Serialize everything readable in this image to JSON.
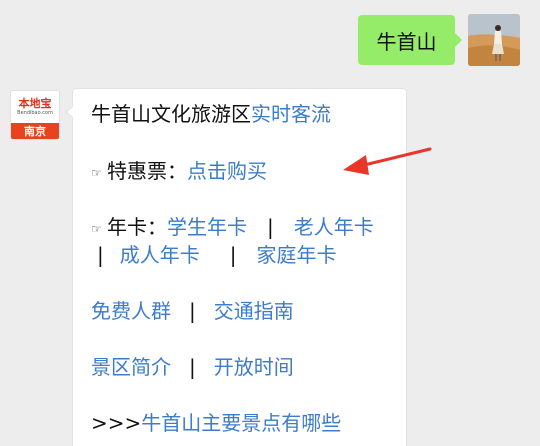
{
  "outgoing": {
    "text": "牛首山"
  },
  "bot": {
    "logo_main": "本地宝",
    "logo_sub": "Bendibao.com",
    "logo_city": "南京"
  },
  "message": {
    "line1": {
      "text": "牛首山文化旅游区",
      "link": "实时客流"
    },
    "line2": {
      "hand": "☞",
      "label": "特惠票：",
      "link": "点击购买"
    },
    "line3": {
      "hand": "☞",
      "label": "年卡：",
      "link1": "学生年卡",
      "sep1": "|",
      "link2": "老人年卡"
    },
    "line4": {
      "sep0": "|",
      "link1": "成人年卡",
      "sep1": "|",
      "link2": "家庭年卡"
    },
    "line5": {
      "link1": "免费人群",
      "sep": "|",
      "link2": "交通指南"
    },
    "line6": {
      "link1": "景区简介",
      "sep": "|",
      "link2": "开放时间"
    },
    "line7": {
      "prefix": ">>>",
      "link": "牛首山主要景点有哪些"
    }
  },
  "colors": {
    "background": "#ededed",
    "outgoing_bubble": "#95ec69",
    "link": "#3d7cc9",
    "annotation_arrow": "#e8362b"
  }
}
